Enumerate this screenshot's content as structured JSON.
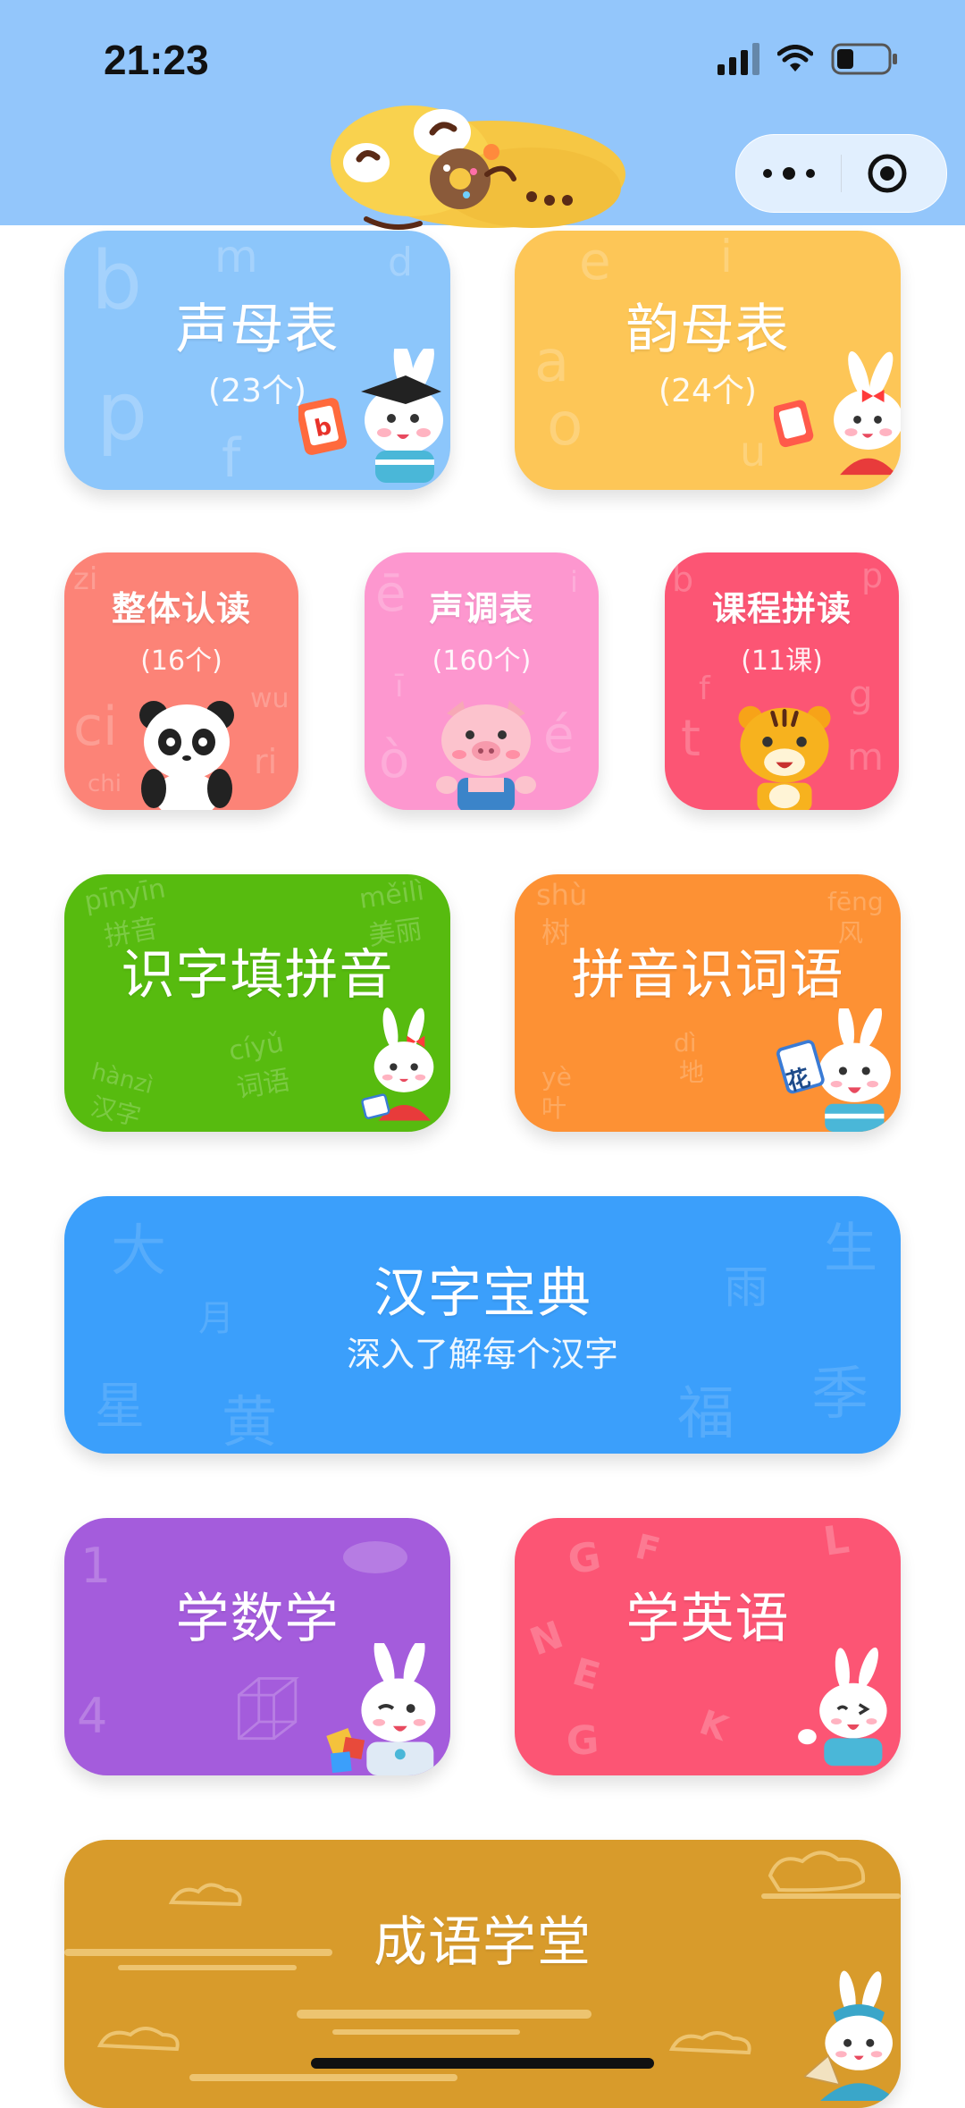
{
  "status": {
    "time": "21:23"
  },
  "cards": {
    "shengmu": {
      "title": "声母表",
      "sub": "(23个)",
      "letters": [
        "b",
        "m",
        "d",
        "p",
        "f"
      ],
      "color": "#8cc6fb"
    },
    "yunmu": {
      "title": "韵母表",
      "sub": "(24个)",
      "letters": [
        "e",
        "i",
        "a",
        "o",
        "u"
      ],
      "color": "#fdc657"
    },
    "zhengti": {
      "title": "整体认读",
      "sub": "(16个)",
      "letters": [
        "zi",
        "ci",
        "wu",
        "ri",
        "chi"
      ],
      "color": "#fc8377"
    },
    "shengdiao": {
      "title": "声调表",
      "sub": "(160个)",
      "letters": [
        "ē",
        "ī",
        "ò",
        "é",
        "i"
      ],
      "color": "#fd97cf"
    },
    "kecheng": {
      "title": "课程拼读",
      "sub": "(11课)",
      "letters": [
        "b",
        "p",
        "f",
        "t",
        "g",
        "m"
      ],
      "color": "#fc5574"
    },
    "shizi": {
      "title": "识字填拼音",
      "color": "#57bb0f",
      "words": [
        {
          "py": "pīnyīn",
          "hz": "拼音"
        },
        {
          "py": "měilì",
          "hz": "美丽"
        },
        {
          "py": "hànzì",
          "hz": "汉字"
        },
        {
          "py": "cíyǔ",
          "hz": "词语"
        }
      ]
    },
    "pinyinci": {
      "title": "拼音识词语",
      "color": "#fd9134",
      "words": [
        {
          "py": "shù",
          "hz": "树"
        },
        {
          "py": "fēng",
          "hz": "风"
        },
        {
          "py": "dì",
          "hz": "地"
        },
        {
          "py": "yè",
          "hz": "叶"
        }
      ],
      "card_char": "花"
    },
    "hanzi": {
      "title": "汉字宝典",
      "sub": "深入了解每个汉字",
      "color": "#3b9ffb",
      "chars": [
        "大",
        "月",
        "星",
        "黄",
        "生",
        "雨",
        "福",
        "季"
      ]
    },
    "shuxue": {
      "title": "学数学",
      "color": "#a45cdc",
      "digits": [
        "1",
        "4"
      ]
    },
    "yingyu": {
      "title": "学英语",
      "color": "#fc5574",
      "letters": [
        "G",
        "F",
        "L",
        "N",
        "E",
        "G",
        "K"
      ]
    },
    "chengyu": {
      "title": "成语学堂",
      "color": "#d89b2b"
    }
  }
}
